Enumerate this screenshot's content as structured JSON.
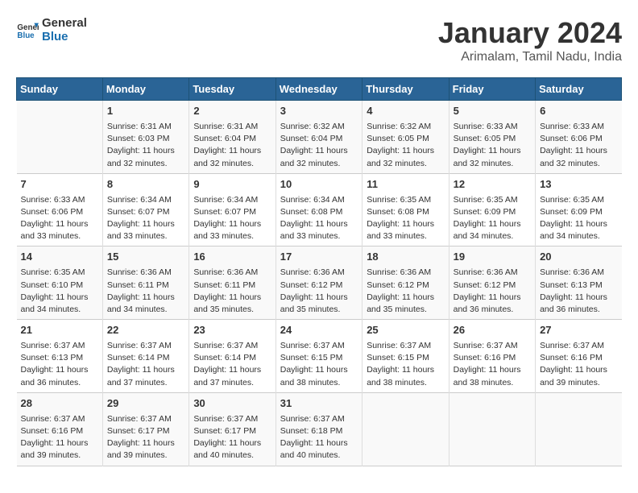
{
  "logo": {
    "text_general": "General",
    "text_blue": "Blue"
  },
  "title": "January 2024",
  "subtitle": "Arimalam, Tamil Nadu, India",
  "headers": [
    "Sunday",
    "Monday",
    "Tuesday",
    "Wednesday",
    "Thursday",
    "Friday",
    "Saturday"
  ],
  "weeks": [
    [
      {
        "day": "",
        "info": ""
      },
      {
        "day": "1",
        "info": "Sunrise: 6:31 AM\nSunset: 6:03 PM\nDaylight: 11 hours\nand 32 minutes."
      },
      {
        "day": "2",
        "info": "Sunrise: 6:31 AM\nSunset: 6:04 PM\nDaylight: 11 hours\nand 32 minutes."
      },
      {
        "day": "3",
        "info": "Sunrise: 6:32 AM\nSunset: 6:04 PM\nDaylight: 11 hours\nand 32 minutes."
      },
      {
        "day": "4",
        "info": "Sunrise: 6:32 AM\nSunset: 6:05 PM\nDaylight: 11 hours\nand 32 minutes."
      },
      {
        "day": "5",
        "info": "Sunrise: 6:33 AM\nSunset: 6:05 PM\nDaylight: 11 hours\nand 32 minutes."
      },
      {
        "day": "6",
        "info": "Sunrise: 6:33 AM\nSunset: 6:06 PM\nDaylight: 11 hours\nand 32 minutes."
      }
    ],
    [
      {
        "day": "7",
        "info": "Sunrise: 6:33 AM\nSunset: 6:06 PM\nDaylight: 11 hours\nand 33 minutes."
      },
      {
        "day": "8",
        "info": "Sunrise: 6:34 AM\nSunset: 6:07 PM\nDaylight: 11 hours\nand 33 minutes."
      },
      {
        "day": "9",
        "info": "Sunrise: 6:34 AM\nSunset: 6:07 PM\nDaylight: 11 hours\nand 33 minutes."
      },
      {
        "day": "10",
        "info": "Sunrise: 6:34 AM\nSunset: 6:08 PM\nDaylight: 11 hours\nand 33 minutes."
      },
      {
        "day": "11",
        "info": "Sunrise: 6:35 AM\nSunset: 6:08 PM\nDaylight: 11 hours\nand 33 minutes."
      },
      {
        "day": "12",
        "info": "Sunrise: 6:35 AM\nSunset: 6:09 PM\nDaylight: 11 hours\nand 34 minutes."
      },
      {
        "day": "13",
        "info": "Sunrise: 6:35 AM\nSunset: 6:09 PM\nDaylight: 11 hours\nand 34 minutes."
      }
    ],
    [
      {
        "day": "14",
        "info": "Sunrise: 6:35 AM\nSunset: 6:10 PM\nDaylight: 11 hours\nand 34 minutes."
      },
      {
        "day": "15",
        "info": "Sunrise: 6:36 AM\nSunset: 6:11 PM\nDaylight: 11 hours\nand 34 minutes."
      },
      {
        "day": "16",
        "info": "Sunrise: 6:36 AM\nSunset: 6:11 PM\nDaylight: 11 hours\nand 35 minutes."
      },
      {
        "day": "17",
        "info": "Sunrise: 6:36 AM\nSunset: 6:12 PM\nDaylight: 11 hours\nand 35 minutes."
      },
      {
        "day": "18",
        "info": "Sunrise: 6:36 AM\nSunset: 6:12 PM\nDaylight: 11 hours\nand 35 minutes."
      },
      {
        "day": "19",
        "info": "Sunrise: 6:36 AM\nSunset: 6:12 PM\nDaylight: 11 hours\nand 36 minutes."
      },
      {
        "day": "20",
        "info": "Sunrise: 6:36 AM\nSunset: 6:13 PM\nDaylight: 11 hours\nand 36 minutes."
      }
    ],
    [
      {
        "day": "21",
        "info": "Sunrise: 6:37 AM\nSunset: 6:13 PM\nDaylight: 11 hours\nand 36 minutes."
      },
      {
        "day": "22",
        "info": "Sunrise: 6:37 AM\nSunset: 6:14 PM\nDaylight: 11 hours\nand 37 minutes."
      },
      {
        "day": "23",
        "info": "Sunrise: 6:37 AM\nSunset: 6:14 PM\nDaylight: 11 hours\nand 37 minutes."
      },
      {
        "day": "24",
        "info": "Sunrise: 6:37 AM\nSunset: 6:15 PM\nDaylight: 11 hours\nand 38 minutes."
      },
      {
        "day": "25",
        "info": "Sunrise: 6:37 AM\nSunset: 6:15 PM\nDaylight: 11 hours\nand 38 minutes."
      },
      {
        "day": "26",
        "info": "Sunrise: 6:37 AM\nSunset: 6:16 PM\nDaylight: 11 hours\nand 38 minutes."
      },
      {
        "day": "27",
        "info": "Sunrise: 6:37 AM\nSunset: 6:16 PM\nDaylight: 11 hours\nand 39 minutes."
      }
    ],
    [
      {
        "day": "28",
        "info": "Sunrise: 6:37 AM\nSunset: 6:16 PM\nDaylight: 11 hours\nand 39 minutes."
      },
      {
        "day": "29",
        "info": "Sunrise: 6:37 AM\nSunset: 6:17 PM\nDaylight: 11 hours\nand 39 minutes."
      },
      {
        "day": "30",
        "info": "Sunrise: 6:37 AM\nSunset: 6:17 PM\nDaylight: 11 hours\nand 40 minutes."
      },
      {
        "day": "31",
        "info": "Sunrise: 6:37 AM\nSunset: 6:18 PM\nDaylight: 11 hours\nand 40 minutes."
      },
      {
        "day": "",
        "info": ""
      },
      {
        "day": "",
        "info": ""
      },
      {
        "day": "",
        "info": ""
      }
    ]
  ]
}
